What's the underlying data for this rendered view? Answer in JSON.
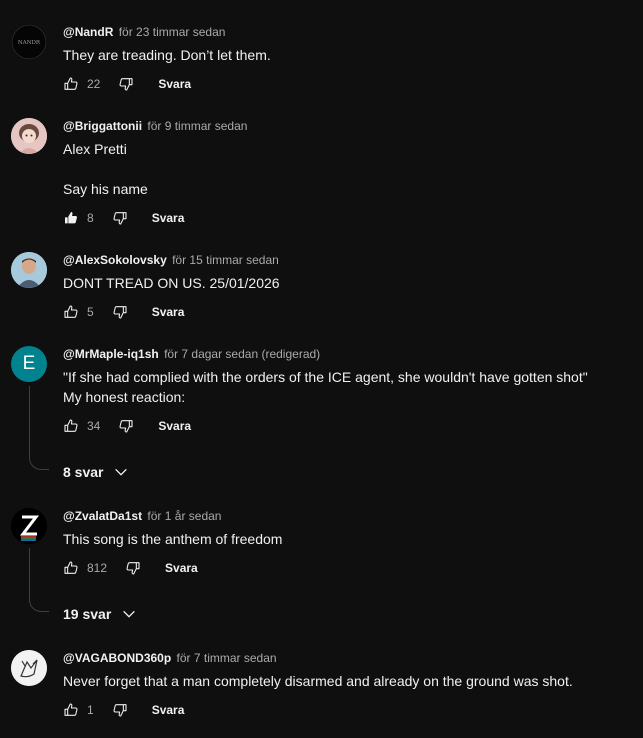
{
  "comments": [
    {
      "author": "@NandR",
      "time": "för 23 timmar sedan",
      "lines": [
        "They are treading. Don’t let them."
      ],
      "likes": "22",
      "reply": "Svara",
      "avatar_text": "NANDR"
    },
    {
      "author": "@Briggattonii",
      "time": "för 9 timmar sedan",
      "lines": [
        "Alex Pretti",
        "",
        "Say his name"
      ],
      "likes": "8",
      "reply": "Svara"
    },
    {
      "author": "@AlexSokolovsky",
      "time": "för 15 timmar sedan",
      "lines": [
        "DONT TREAD ON US. 25/01/2026"
      ],
      "likes": "5",
      "reply": "Svara"
    },
    {
      "author": "@MrMaple-iq1sh",
      "time": "för 7 dagar sedan (redigerad)",
      "lines": [
        "\"If she had complied with the orders of the ICE agent, she wouldn't have gotten shot\"",
        "My honest reaction:"
      ],
      "likes": "34",
      "reply": "Svara",
      "replies": "8 svar",
      "avatar_text": "E"
    },
    {
      "author": "@ZvalatDa1st",
      "time": "för 1 år sedan",
      "lines": [
        "This song is the anthem of freedom"
      ],
      "likes": "812",
      "reply": "Svara",
      "replies": "19 svar",
      "avatar_text": "Z"
    },
    {
      "author": "@VAGABOND360p",
      "time": "för 7 timmar sedan",
      "lines": [
        "Never forget that a man completely disarmed and already  on the ground was shot."
      ],
      "likes": "1",
      "reply": "Svara"
    }
  ],
  "colors": {
    "background": "#0f0f0f",
    "text": "#f1f1f1",
    "secondary": "#aaaaaa",
    "teal_avatar": "#00838f"
  },
  "icons": [
    "thumb-up-icon",
    "thumb-up-filled-icon",
    "thumb-down-icon",
    "chevron-down-icon"
  ]
}
